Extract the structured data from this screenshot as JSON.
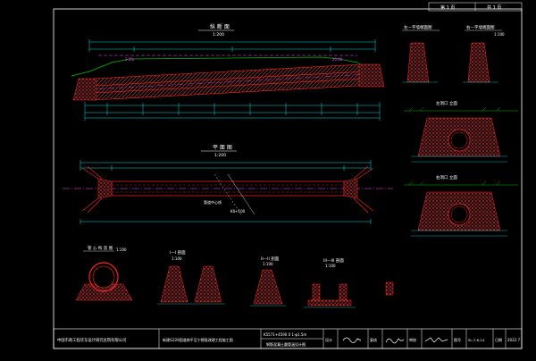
{
  "sheet": {
    "page_label_left": "第 1 页",
    "page_label_right": "共 1 页"
  },
  "titles": {
    "profile": "纵 断 面",
    "profile_scale": "1:200",
    "plan": "平 面 图",
    "plan_scale": "1:200",
    "wing_section_left": "左—字墙端面图",
    "wing_section_right": "右—字墙端面图",
    "wing_scale": "1:100",
    "left_elevation": "左洞口 立面",
    "right_elevation": "右洞口 立面",
    "pipe_section": "管 心 构 造 图",
    "pipe_section_scale": "1:100",
    "section_1": "I—I 剖面",
    "section_1_scale": "1:100",
    "section_2": "II—II 剖面",
    "section_2_scale": "1:100",
    "section_3": "III—III 剖面",
    "section_3_scale": "1:100",
    "plan_note": "管道中心线",
    "plan_station": "K0+100",
    "elev_tag_1": "2.5%",
    "elev_tag_2": "20.00"
  },
  "title_block": {
    "company": "中国市政工程华东设计研究总院有限公司",
    "project": "新建G228国道南平至宁德段改建工程施工图",
    "station": "K5571+4590 0  1-φ1.5m",
    "drawing_name": "钢筋混凝土圆管涵设计图",
    "design_label": "设计",
    "check_label": "复核",
    "review_label": "审核",
    "drawing_no_label": "图号",
    "drawing_no": "SL-7-6-14",
    "date_label": "日期",
    "date": "2022.7"
  },
  "colors": {
    "background": "#000000",
    "frame": "#ffffff",
    "structure": "#ff2020",
    "dimension": "#00e0e0",
    "centerline": "#ff40ff",
    "ground": "#00c000",
    "text": "#ffffff",
    "fill": "#d04a4a"
  }
}
